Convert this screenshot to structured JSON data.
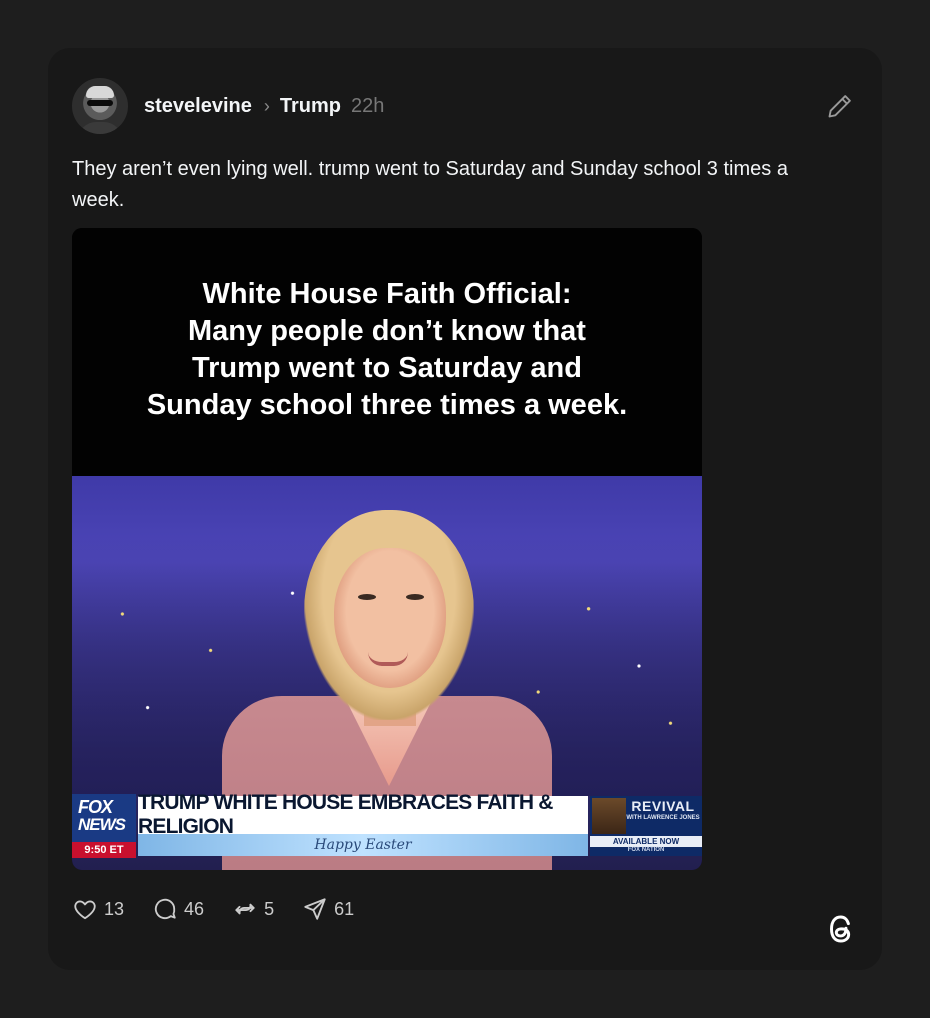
{
  "post": {
    "username": "stevelevine",
    "separator": "›",
    "topic": "Trump",
    "time": "22h",
    "text": "They aren’t even lying well. trump went to Saturday and Sunday school 3 times a week."
  },
  "media": {
    "caption_line1": "White House Faith Official:",
    "caption_line2": "Many people don’t know that",
    "caption_line3": "Trump went to Saturday and",
    "caption_line4": "Sunday school three times a week.",
    "fox_word": "FOX",
    "fox_news": "NEWS",
    "fox_time": "9:50 ET",
    "headline": "TRUMP WHITE HOUSE EMBRACES FAITH & RELIGION",
    "subheadline": "Happy Easter",
    "promo_title": "REVIVAL",
    "promo_with": "WITH LAWRENCE JONES",
    "promo_available": "AVAILABLE NOW",
    "promo_nation": "FOX NATION"
  },
  "actions": {
    "likes": "13",
    "comments": "46",
    "reposts": "5",
    "shares": "61"
  },
  "icons": {
    "edit": "pencil-icon",
    "like": "heart-icon",
    "comment": "comment-icon",
    "repost": "repost-icon",
    "share": "share-icon",
    "brand": "threads-logo-icon"
  },
  "colors": {
    "background": "#1e1e1e",
    "card": "#181818",
    "text": "#f3f5f7",
    "muted": "#777777"
  }
}
